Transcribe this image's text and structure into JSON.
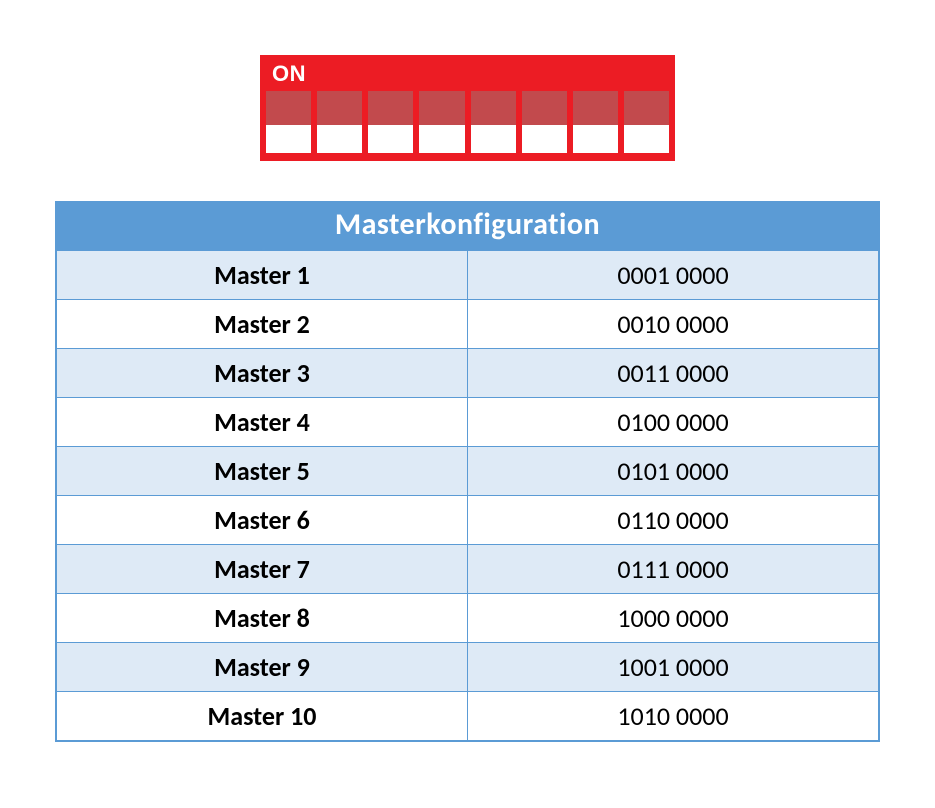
{
  "dip": {
    "label": "ON",
    "switch_count": 8
  },
  "table": {
    "title": "Masterkonfiguration",
    "rows": [
      {
        "name": "Master 1",
        "value": "0001 0000",
        "shaded": true
      },
      {
        "name": "Master 2",
        "value": "0010 0000",
        "shaded": false
      },
      {
        "name": "Master 3",
        "value": "0011 0000",
        "shaded": true
      },
      {
        "name": "Master 4",
        "value": "0100 0000",
        "shaded": false
      },
      {
        "name": "Master 5",
        "value": "0101 0000",
        "shaded": true
      },
      {
        "name": "Master 6",
        "value": "0110 0000",
        "shaded": false
      },
      {
        "name": "Master 7",
        "value": "0111 0000",
        "shaded": true
      },
      {
        "name": "Master 8",
        "value": "1000 0000",
        "shaded": false
      },
      {
        "name": "Master 9",
        "value": "1001 0000",
        "shaded": true
      },
      {
        "name": "Master 10",
        "value": "1010 0000",
        "shaded": false
      }
    ]
  },
  "colors": {
    "dip_background": "#ec1c24",
    "switch_top": "#c24a4d",
    "switch_bottom": "#ffffff",
    "table_header": "#5b9bd5",
    "row_shaded": "#deeaf6"
  }
}
